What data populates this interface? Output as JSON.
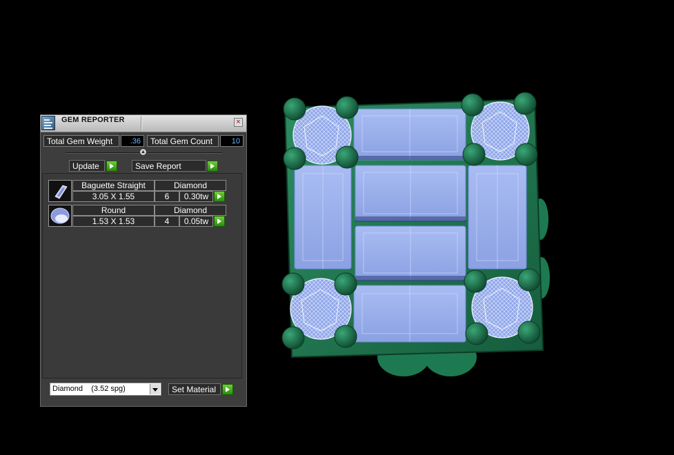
{
  "panel": {
    "title": "GEM REPORTER",
    "close_label": "×",
    "stats": {
      "weight_label": "Total Gem Weight",
      "weight_value": ".36",
      "count_label": "Total Gem Count",
      "count_value": "10"
    },
    "buttons": {
      "update": "Update",
      "save_report": "Save Report"
    },
    "gems": [
      {
        "shape": "Baguette Straight",
        "material": "Diamond",
        "size": "3.05 X 1.55",
        "count": "6",
        "weight": "0.30tw"
      },
      {
        "shape": "Round",
        "material": "Diamond",
        "size": "1.53 X 1.53",
        "count": "4",
        "weight": "0.05tw"
      }
    ],
    "material_select": "Diamond    (3.52 spg)",
    "set_material": "Set Material"
  },
  "colors": {
    "panel_bg": "#3d3d3d",
    "value_text": "#6cb6ff",
    "go_button": "#3da51a",
    "metal": "#1e7a52",
    "gem_fill": "#9fb4ee"
  },
  "icons": [
    "app-icon",
    "close-icon",
    "baguette-gem-icon",
    "round-gem-icon",
    "play-arrow-icon",
    "chevron-down-icon"
  ]
}
